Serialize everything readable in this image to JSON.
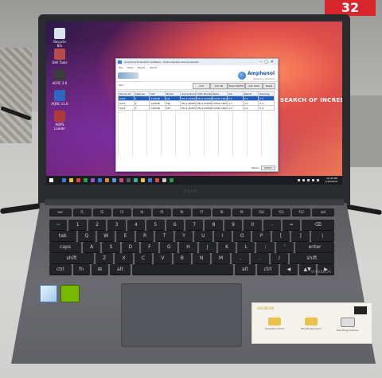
{
  "badge": {
    "text": "32",
    "color": "#d8262c"
  },
  "desktop_icons": [
    {
      "label": "Recycle Bin",
      "icon": "recycle-bin-icon",
      "color": "#d9e4ee"
    },
    {
      "label": "Dell Tools",
      "icon": "app-icon",
      "color": "#b84a4a"
    },
    {
      "label": "ACRC 2.0",
      "icon": "app-icon",
      "color": "#3c3c3c"
    },
    {
      "label": "AQRC v1.0",
      "icon": "app-a-icon",
      "color": "#2f66c2"
    },
    {
      "label": "AQPS Loader",
      "icon": "app-icon",
      "color": "#b03a3a"
    }
  ],
  "app_window": {
    "title": "Amphenol Evaluation Software - Multi-Interface Device Reader",
    "menu": [
      "File",
      "Tools",
      "Board",
      "About"
    ],
    "brand": "Amphenol",
    "brand_tagline": "Sensors / Sensors",
    "tab_label": "Test",
    "buttons": [
      "Add",
      "Get SN",
      "Read SN/FW",
      "Get Data",
      "Reset"
    ],
    "columns": [
      "Device ID",
      "Channel",
      "S/N",
      "Model",
      "Serial Number",
      "CMC Number",
      "Read",
      "Set",
      "Result",
      "Reading"
    ],
    "rows": [
      [
        "0x40",
        "1",
        "21094B",
        "5W",
        "PN 9-300600",
        "PN 9-300600-101",
        "COM4 CIRCUIT 1-2-2016",
        "0.2",
        "2.0",
        "0.5"
      ],
      [
        "0x41",
        "2",
        "21094B",
        "5W",
        "PN 9-300600",
        "PN 9-300600-101",
        "COM4 CIRCUIT 1-2-2016",
        "0.3",
        "2.0",
        "0.4"
      ],
      [
        "0x42",
        "3",
        "21094B",
        "5W",
        "PN 9-300600",
        "PN 9-300600-101",
        "COM4 CIRCUIT 1-2-2016",
        "0.3",
        "2.0",
        "0.4"
      ]
    ],
    "selected_row": 0,
    "status_label": "Status",
    "status_button": "RESET"
  },
  "wallpaper_text": "SEARCH OF INCREDIBLE",
  "taskbar": {
    "clock_time": "12:45 PM",
    "clock_date": "1/15/2019",
    "app_colors": [
      "#3a7bd5",
      "#f0c33c",
      "#e04a3a",
      "#2f9b4f",
      "#9a56c8",
      "#3a7bd5",
      "#e08a2a",
      "#4aa0d8",
      "#d04a80",
      "#5b5b5b",
      "#3ab0a0",
      "#f0c33c",
      "#3a7bd5",
      "#e04a3a",
      "#cccccc",
      "#2f9b4f"
    ]
  },
  "laptop": {
    "brand": "ASUS",
    "model_text": "VIVOBOOK",
    "promo_heading": "VIVOBOOK",
    "promo_features": [
      "Dual-Band Wi-Fi",
      "Backlit Keyboard",
      "NanoEdge Display"
    ]
  },
  "keyboard_rows": [
    [
      "esc",
      "f1",
      "f2",
      "f3",
      "f4",
      "f5",
      "f6",
      "f7",
      "f8",
      "f9",
      "f10",
      "f11",
      "f12",
      "del"
    ],
    [
      "~",
      "1",
      "2",
      "3",
      "4",
      "5",
      "6",
      "7",
      "8",
      "9",
      "0",
      "-",
      "=",
      "⌫"
    ],
    [
      "tab",
      "Q",
      "W",
      "E",
      "R",
      "T",
      "Y",
      "U",
      "I",
      "O",
      "P",
      "[",
      "]",
      "\\"
    ],
    [
      "caps",
      "A",
      "S",
      "D",
      "F",
      "G",
      "H",
      "J",
      "K",
      "L",
      ";",
      "'",
      "enter"
    ],
    [
      "shift",
      "Z",
      "X",
      "C",
      "V",
      "B",
      "N",
      "M",
      ",",
      ".",
      "/",
      "shift"
    ],
    [
      "ctrl",
      "fn",
      "⊞",
      "alt",
      "",
      "alt",
      "ctrl",
      "◀",
      "▲▼",
      "▶"
    ]
  ]
}
